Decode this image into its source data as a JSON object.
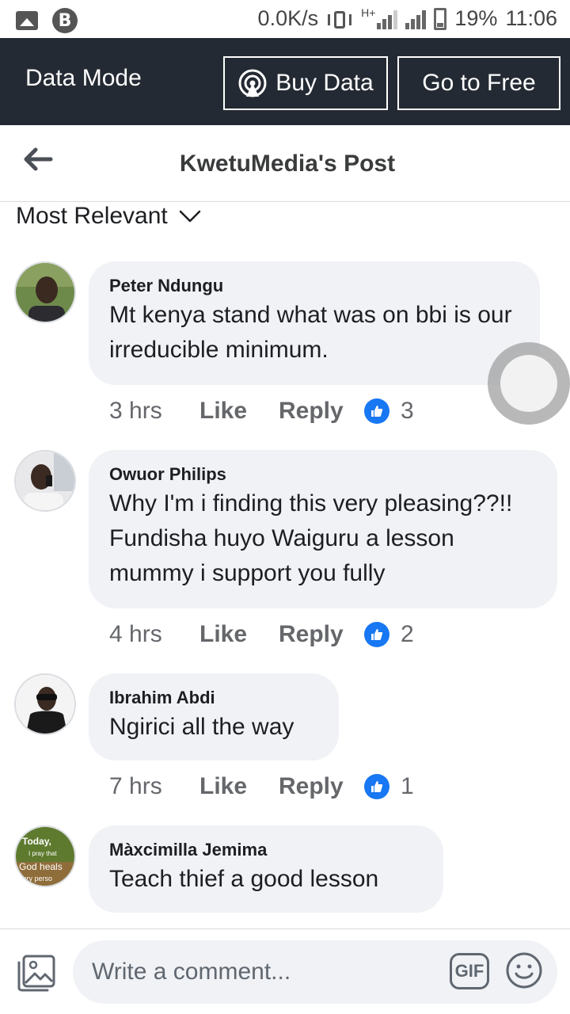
{
  "status_bar": {
    "net_speed": "0.0K/s",
    "network_type": "H+",
    "battery_percent": "19%",
    "time": "11:06"
  },
  "data_mode_bar": {
    "label": "Data Mode",
    "buy_data": "Buy Data",
    "go_to_free": "Go to Free"
  },
  "header": {
    "title": "KwetuMedia's Post"
  },
  "sort": {
    "label": "Most Relevant"
  },
  "comments": [
    {
      "name": "Peter Ndungu",
      "text": "Mt kenya stand what was on bbi is our irreducible minimum.",
      "time": "3 hrs",
      "like": "Like",
      "reply": "Reply",
      "reactions": "3"
    },
    {
      "name": "Owuor Philips",
      "text": "Why I'm i finding this very pleasing??!! Fundisha huyo Waiguru a lesson mummy i support you fully",
      "time": "4 hrs",
      "like": "Like",
      "reply": "Reply",
      "reactions": "2"
    },
    {
      "name": "Ibrahim Abdi",
      "text": "Ngirici all the way",
      "time": "7 hrs",
      "like": "Like",
      "reply": "Reply",
      "reactions": "1"
    },
    {
      "name": "Màxcimilla Jemima",
      "text": "Teach thief a good lesson",
      "avatar_text": [
        "Today,",
        "I pray that",
        "God heals",
        "very perso"
      ]
    }
  ],
  "composer": {
    "placeholder": "Write a comment...",
    "gif_label": "GIF"
  },
  "colors": {
    "data_bar_bg": "#242a33",
    "bubble_bg": "#f0f2f5",
    "like_blue": "#1877f2"
  }
}
